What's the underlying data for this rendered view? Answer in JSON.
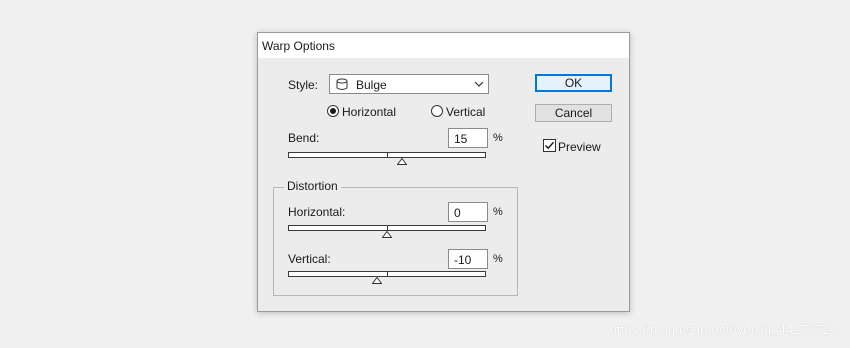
{
  "dialog": {
    "title": "Warp Options",
    "style": {
      "label": "Style:",
      "value": "Bulge",
      "icon": "bulge-icon"
    },
    "orientation": {
      "horizontal_label": "Horizontal",
      "vertical_label": "Vertical",
      "selected": "Horizontal"
    },
    "bend": {
      "label": "Bend:",
      "value": "15",
      "unit": "%",
      "percent": 15
    },
    "distortion": {
      "title": "Distortion",
      "horizontal": {
        "label": "Horizontal:",
        "value": "0",
        "unit": "%",
        "percent": 0
      },
      "vertical": {
        "label": "Vertical:",
        "value": "-10",
        "unit": "%",
        "percent": -10
      }
    },
    "buttons": {
      "ok": "OK",
      "cancel": "Cancel"
    },
    "preview": {
      "label": "Preview",
      "checked": true
    }
  },
  "watermark": "https://blog.csdn.net/weixin_44173720",
  "colors": {
    "accent": "#0078d7",
    "background": "#f0f0f0",
    "dialog": "#ececec"
  }
}
